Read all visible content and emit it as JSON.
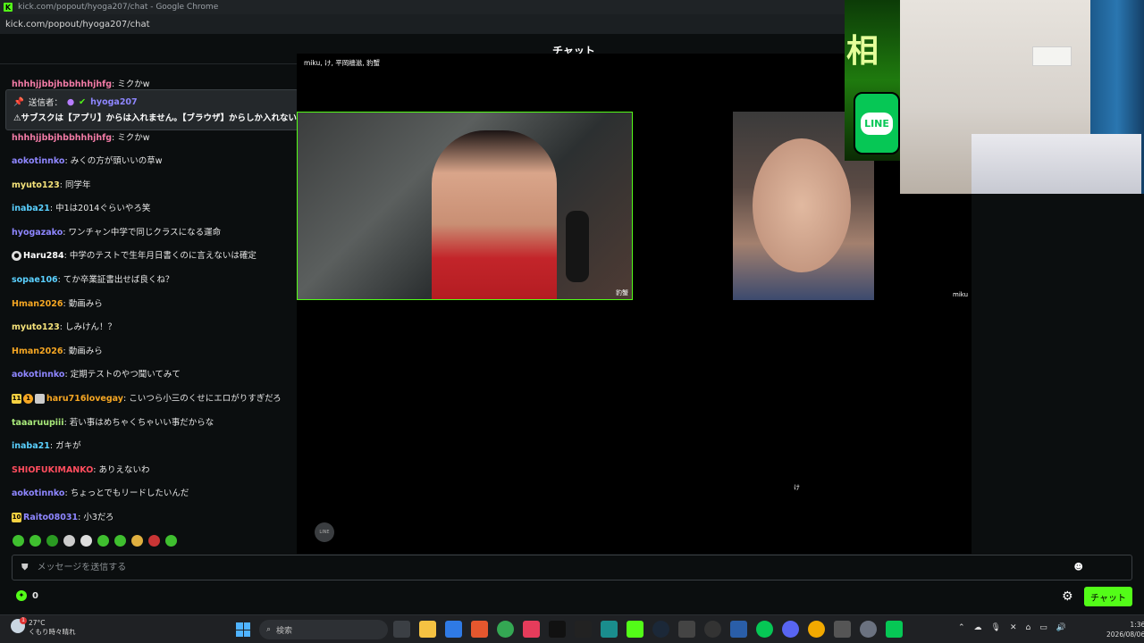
{
  "window": {
    "title": "kick.com/popout/hyoga207/chat - Google Chrome",
    "url": "kick.com/popout/hyoga207/chat"
  },
  "chat_header": {
    "title": "チャット"
  },
  "pinned": {
    "sender_label": "送信者：",
    "sender_name": "hyoga207",
    "text": "⚠サブスクは【アプリ】からは入れません。【ブラウザ】からしか入れない"
  },
  "messages": [
    {
      "user": "hhhhjjbbjhbbhhhjhfg",
      "text": "ミクかw",
      "color": "#f27ba6"
    },
    {
      "user": "aokotinnko",
      "text": "みくの方が頭いいの草w",
      "color": "#8e86ff"
    },
    {
      "user": "myuto123",
      "text": "同学年",
      "color": "#f5e27a"
    },
    {
      "user": "inaba21",
      "text": "中1は2014ぐらいやろ笑",
      "color": "#5ad0ff"
    },
    {
      "user": "hyogazako",
      "text": "ワンチャン中学で同じクラスになる運命",
      "color": "#8e86ff"
    },
    {
      "user": "Haru284",
      "text": "中学のテストで生年月日書くのに言えないは確定",
      "color": "#ffffff"
    },
    {
      "user": "sopae106",
      "text": "てか卒業証書出せば良くね？",
      "color": "#5ad0ff"
    },
    {
      "user": "Hman2026",
      "text": "動画みら",
      "color": "#f5a623"
    },
    {
      "user": "myuto123",
      "text": "しみけん！？",
      "color": "#f5e27a"
    },
    {
      "user": "Hman2026",
      "text": "動画みら",
      "color": "#f5a623"
    },
    {
      "user": "aokotinnko",
      "text": "定期テストのやつ聞いてみて",
      "color": "#8e86ff"
    },
    {
      "user": "haru716lovegay",
      "text": "こいつら小三のくせにエロがりすぎだろ",
      "color": "#f5a623"
    },
    {
      "user": "taaaruupiii",
      "text": "若い事はめちゃくちゃいい事だからな",
      "color": "#a8e87a"
    },
    {
      "user": "inaba21",
      "text": "ガキが",
      "color": "#5ad0ff"
    },
    {
      "user": "SHIOFUKIMANKO",
      "text": "ありえないわ",
      "color": "#ff4d5e"
    },
    {
      "user": "aokotinnko",
      "text": "ちょっとでもリードしたいんだ",
      "color": "#8e86ff"
    },
    {
      "user": "Raito08031",
      "text": "小3だろ",
      "color": "#8e86ff"
    }
  ],
  "badges": {
    "haru_badges": [
      "11",
      "1"
    ],
    "raito_badge": "10"
  },
  "stream": {
    "participants_label": "miku, け, 平岡檣滋, 豹蟹",
    "cam1_name": "豹蟹",
    "cam2_name": "miku",
    "cam3_name": "け",
    "overlay_char": "相",
    "line_text": "LINE",
    "line_small": "LINE"
  },
  "input": {
    "placeholder": "メッセージを送信する"
  },
  "footer": {
    "points": "0",
    "chat_button": "チャット"
  },
  "taskbar": {
    "temperature": "27°C",
    "weather": "くもり時々晴れ",
    "weather_alert": "1",
    "search_placeholder": "検索",
    "time": "1:36",
    "date": "2026/08/06"
  },
  "colors": {
    "accent": "#53fc18",
    "background": "#0b0e0f"
  }
}
